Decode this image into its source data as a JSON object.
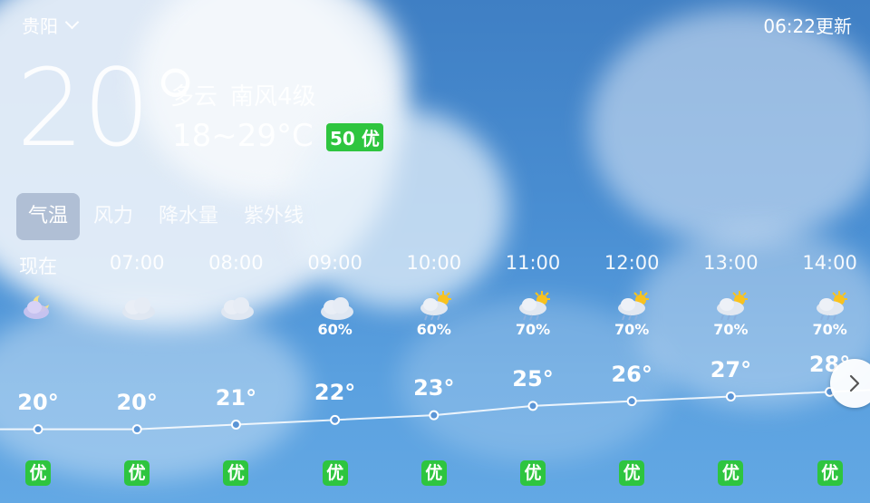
{
  "header": {
    "city": "贵阳",
    "updated": "06:22更新"
  },
  "current": {
    "temp": "20°",
    "condition": "多云",
    "wind": "南风4级",
    "range": "18~29°C",
    "aqi_value": "50",
    "aqi_label": "优"
  },
  "tabs": [
    {
      "label": "气温",
      "active": true
    },
    {
      "label": "风力",
      "active": false
    },
    {
      "label": "降水量",
      "active": false
    },
    {
      "label": "紫外线",
      "active": false
    }
  ],
  "hourly": [
    {
      "time": "现在",
      "icon": "moon-cloud-icon",
      "precip": "",
      "temp": "20°",
      "temp_value": 20,
      "air": "优"
    },
    {
      "time": "07:00",
      "icon": "cloud-icon",
      "precip": "",
      "temp": "20°",
      "temp_value": 20,
      "air": "优"
    },
    {
      "time": "08:00",
      "icon": "cloud-icon",
      "precip": "",
      "temp": "21°",
      "temp_value": 21,
      "air": "优"
    },
    {
      "time": "09:00",
      "icon": "cloud-icon",
      "precip": "60%",
      "temp": "22°",
      "temp_value": 22,
      "air": "优"
    },
    {
      "time": "10:00",
      "icon": "sun-rain-icon",
      "precip": "60%",
      "temp": "23°",
      "temp_value": 23,
      "air": "优"
    },
    {
      "time": "11:00",
      "icon": "sun-rain-icon",
      "precip": "70%",
      "temp": "25°",
      "temp_value": 25,
      "air": "优"
    },
    {
      "time": "12:00",
      "icon": "sun-rain-icon",
      "precip": "70%",
      "temp": "26°",
      "temp_value": 26,
      "air": "优"
    },
    {
      "time": "13:00",
      "icon": "sun-rain-icon",
      "precip": "70%",
      "temp": "27°",
      "temp_value": 27,
      "air": "优"
    },
    {
      "time": "14:00",
      "icon": "sun-rain-icon",
      "precip": "70%",
      "temp": "28°",
      "temp_value": 28,
      "air": "优"
    }
  ],
  "colors": {
    "aqi_good": "#2ec53f",
    "sky": "#4a8fd3"
  }
}
